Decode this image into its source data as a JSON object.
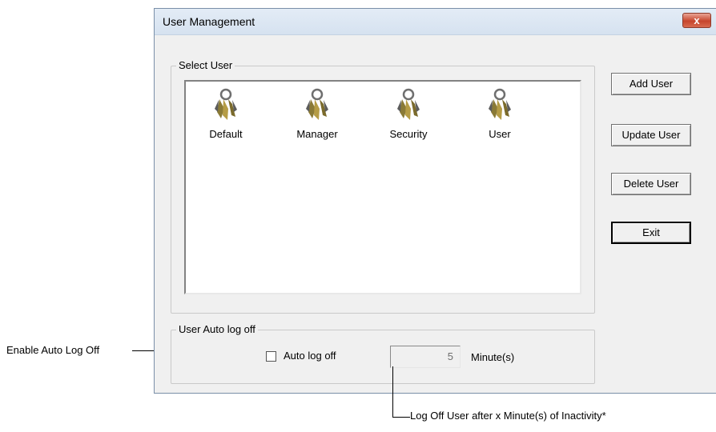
{
  "window": {
    "title": "User Management",
    "close_glyph": "x"
  },
  "select_user": {
    "legend": "Select User",
    "users": [
      {
        "label": "Default",
        "icon": "keys-icon"
      },
      {
        "label": "Manager",
        "icon": "keys-icon"
      },
      {
        "label": "Security",
        "icon": "keys-icon"
      },
      {
        "label": "User",
        "icon": "keys-icon"
      }
    ]
  },
  "buttons": {
    "add": "Add User",
    "update": "Update User",
    "delete": "Delete User",
    "exit": "Exit"
  },
  "auto_logoff": {
    "legend": "User Auto log off",
    "checkbox_label": "Auto log off",
    "checked": false,
    "minutes_value": "5",
    "minutes_label": "Minute(s)"
  },
  "annotations": {
    "enable": "Enable Auto Log Off",
    "inactivity": "Log Off User after x Minute(s) of Inactivity*"
  },
  "colors": {
    "titlebar": "#dbe5f1",
    "close": "#c6452c",
    "dialog_bg": "#f0f0f0"
  }
}
